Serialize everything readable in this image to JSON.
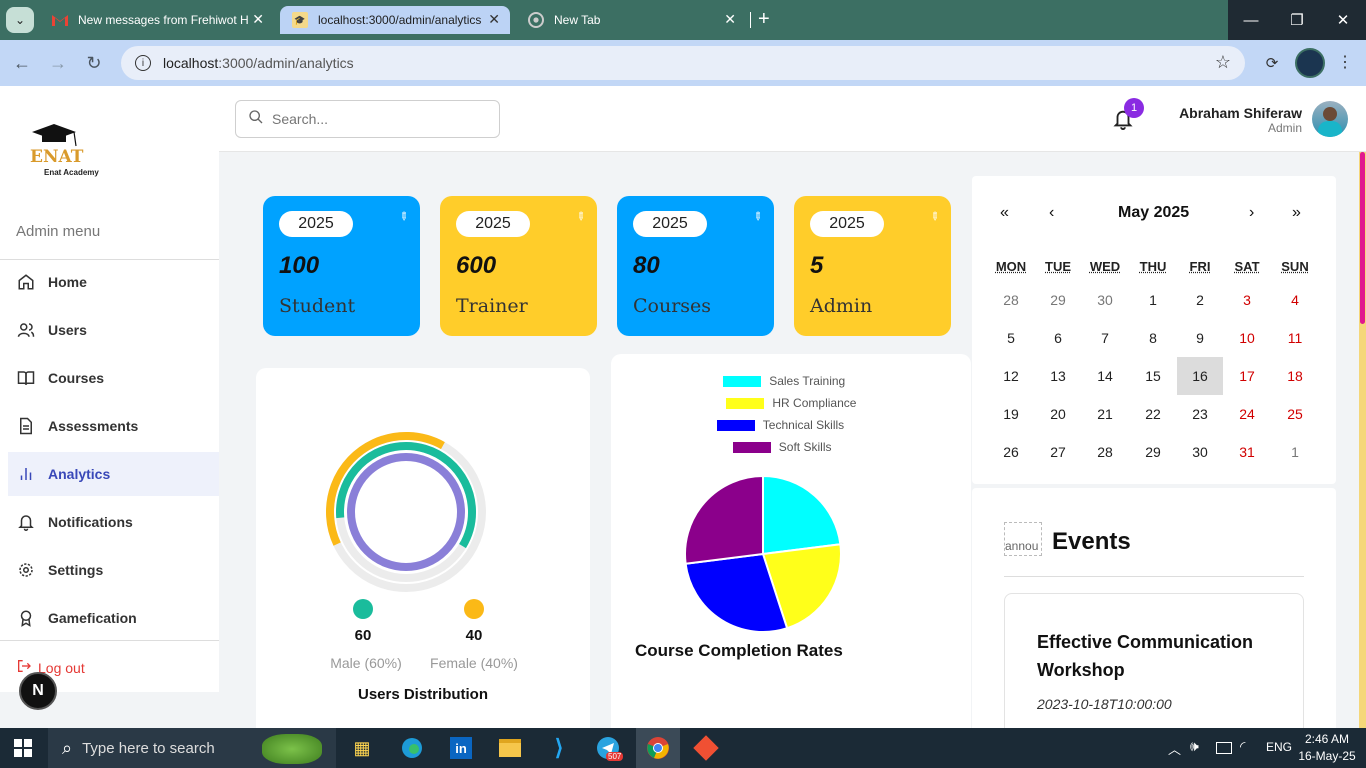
{
  "browser": {
    "tabs": [
      {
        "title": "New messages from Frehiwot H",
        "icon": "gmail-icon"
      },
      {
        "title": "localhost:3000/admin/analytics",
        "icon": "site-favicon"
      },
      {
        "title": "New Tab",
        "icon": "chrome-icon"
      }
    ],
    "url_host": "localhost",
    "url_path": ":3000/admin/analytics"
  },
  "sidebar": {
    "logo_text": "ENAT",
    "logo_sub": "Enat Academy",
    "menu_title": "Admin menu",
    "items": [
      {
        "label": "Home",
        "icon": "home-icon"
      },
      {
        "label": "Users",
        "icon": "users-icon"
      },
      {
        "label": "Courses",
        "icon": "book-icon"
      },
      {
        "label": "Assessments",
        "icon": "document-icon"
      },
      {
        "label": "Analytics",
        "icon": "bar-chart-icon",
        "active": true
      },
      {
        "label": "Notifications",
        "icon": "bell-icon"
      },
      {
        "label": "Settings",
        "icon": "gear-icon"
      },
      {
        "label": "Gamefication",
        "icon": "award-icon"
      }
    ],
    "logout": "Log out",
    "devtools_badge": "N"
  },
  "header": {
    "search_placeholder": "Search...",
    "notification_count": "1",
    "user_name": "Abraham Shiferaw",
    "user_role": "Admin"
  },
  "stats": [
    {
      "year": "2025",
      "value": "100",
      "label": "Student",
      "color": "#00a2ff"
    },
    {
      "year": "2025",
      "value": "600",
      "label": "Trainer",
      "color": "#ffcd2a"
    },
    {
      "year": "2025",
      "value": "80",
      "label": "Courses",
      "color": "#00a2ff"
    },
    {
      "year": "2025",
      "value": "5",
      "label": "Admin",
      "color": "#ffcd2a"
    }
  ],
  "users_chart": {
    "title": "Users Distribution",
    "male_count": "60",
    "female_count": "40",
    "male_label": "Male (60%)",
    "female_label": "Female (40%)",
    "male_color": "#1abc9c",
    "female_color": "#fbb917",
    "inner_color": "#8a7fd8"
  },
  "chart_data": {
    "type": "pie",
    "title": "Course Completion Rates",
    "categories": [
      "Sales Training",
      "HR Compliance",
      "Technical Skills",
      "Soft Skills"
    ],
    "values": [
      23,
      22,
      28,
      27
    ],
    "colors": [
      "#00ffff",
      "#ffff1a",
      "#0000ff",
      "#8b008b"
    ],
    "legend_position": "top"
  },
  "calendar": {
    "month_label": "May 2025",
    "nav": [
      "«",
      "‹",
      "›",
      "»"
    ],
    "weekdays": [
      "MON",
      "TUE",
      "WED",
      "THU",
      "FRI",
      "SAT",
      "SUN"
    ],
    "weeks": [
      [
        "28",
        "29",
        "30",
        "1",
        "2",
        "3",
        "4"
      ],
      [
        "5",
        "6",
        "7",
        "8",
        "9",
        "10",
        "11"
      ],
      [
        "12",
        "13",
        "14",
        "15",
        "16",
        "17",
        "18"
      ],
      [
        "19",
        "20",
        "21",
        "22",
        "23",
        "24",
        "25"
      ],
      [
        "26",
        "27",
        "28",
        "29",
        "30",
        "31",
        "1"
      ]
    ],
    "today": "16"
  },
  "events": {
    "title": "Events",
    "icon_alt": "annou",
    "items": [
      {
        "name": "Effective Communication Workshop",
        "date": "2023-10-18T10:00:00"
      }
    ]
  },
  "taskbar": {
    "search_placeholder": "Type here to search",
    "time": "2:46 AM",
    "date": "16-May-25",
    "language": "ENG",
    "telegram_badge": "507"
  }
}
